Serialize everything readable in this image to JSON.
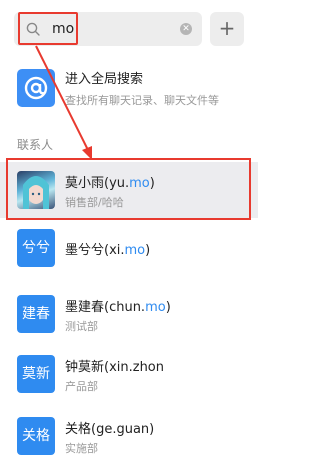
{
  "search": {
    "value": "mo",
    "icon": "search-icon",
    "clear_icon": "clear-icon"
  },
  "add_button": {
    "label": "+"
  },
  "global_search": {
    "title": "进入全局搜索",
    "subtitle": "查找所有聊天记录、聊天文件等",
    "icon": "at-sign-icon"
  },
  "section_title": "联系人",
  "contacts": [
    {
      "name_pre": "莫小雨(yu.",
      "name_hit": "mo",
      "name_post": ")",
      "dept": "销售部/哈哈",
      "avatar_text": "",
      "selected": true
    },
    {
      "name_pre": "墨兮兮(xi.",
      "name_hit": "mo",
      "name_post": ")",
      "dept": "",
      "avatar_text": "兮兮",
      "selected": false
    },
    {
      "name_pre": "墨建春(chun.",
      "name_hit": "mo",
      "name_post": ")",
      "dept": "测试部",
      "avatar_text": "建春",
      "selected": false
    },
    {
      "name_pre": "钟莫新(xin.zhon",
      "name_hit": "",
      "name_post": "",
      "dept": "产品部",
      "avatar_text": "莫新",
      "selected": false
    },
    {
      "name_pre": "关格(ge.guan)",
      "name_hit": "",
      "name_post": "",
      "dept": "实施部",
      "avatar_text": "关格",
      "selected": false
    }
  ],
  "colors": {
    "accent": "#2f8bf0",
    "highlight_border": "#e83a2f",
    "selected_bg": "#ececef"
  }
}
